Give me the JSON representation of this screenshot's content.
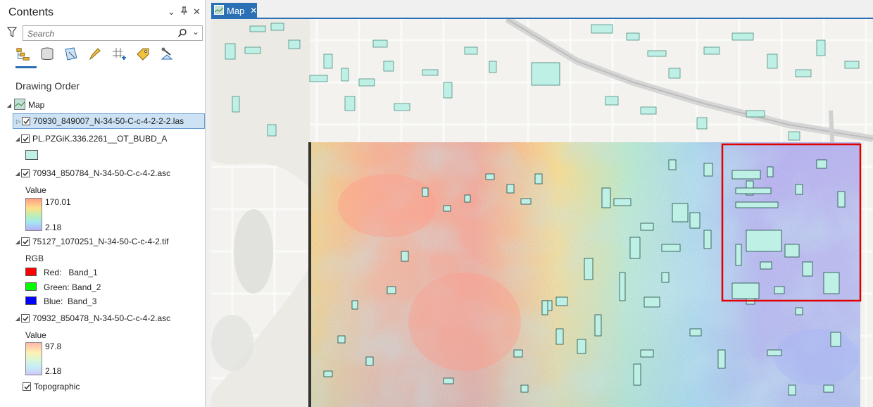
{
  "contents": {
    "title": "Contents",
    "search_placeholder": "Search",
    "section_title": "Drawing Order",
    "map_label": "Map",
    "layers": {
      "las": "70930_849007_N-34-50-C-c-4-2-2-2.las",
      "buildings": "PL.PZGiK.336.2261__OT_BUBD_A",
      "asc1": "70934_850784_N-34-50-C-c-4-2.asc",
      "tif": "75127_1070251_N-34-50-C-c-4-2.tif",
      "asc2": "70932_850478_N-34-50-C-c-4-2.asc",
      "topo": "Topographic"
    },
    "asc1_legend": {
      "title": "Value",
      "max": "170.01",
      "min": "2.18"
    },
    "tif_legend": {
      "title": "RGB",
      "red": "Red:   Band_1",
      "green": "Green: Band_2",
      "blue": "Blue:  Band_3"
    },
    "asc2_legend": {
      "title": "Value",
      "max": "97.8",
      "min": "2.18"
    },
    "colors": {
      "red": "#ff0000",
      "green": "#00ff00",
      "blue": "#0000ff",
      "building_fill": "#bff0e6",
      "accent": "#2b6fb4",
      "selection": "#e00000"
    },
    "icons": [
      "filter-icon",
      "magnifier-icon",
      "list-by-drawing-order-icon",
      "list-by-source-icon",
      "list-by-selection-icon",
      "list-by-editing-icon",
      "list-by-snapping-icon",
      "list-by-labeling-icon",
      "list-by-perspective-icon"
    ]
  },
  "map_tab": {
    "label": "Map",
    "close": "✕"
  }
}
